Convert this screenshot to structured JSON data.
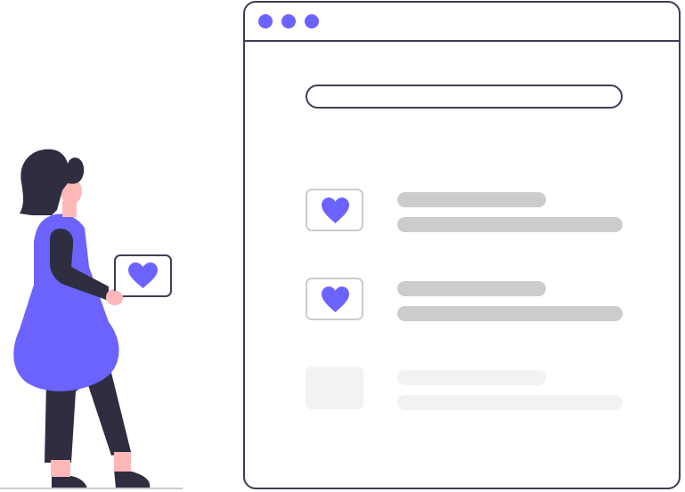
{
  "colors": {
    "accent": "#6c63ff",
    "outline": "#3f3d56",
    "placeholder": "#cccccc",
    "placeholder_faded": "#f2f2f2",
    "skin": "#ffb8b8",
    "dark": "#2f2e41"
  },
  "browser": {
    "window_dots": [
      "accent-dot",
      "accent-dot",
      "accent-dot"
    ],
    "search_bar": {
      "value": ""
    },
    "list_items": [
      {
        "icon": "heart-icon",
        "state": "liked"
      },
      {
        "icon": "heart-icon",
        "state": "liked"
      },
      {
        "icon": "none",
        "state": "placeholder"
      }
    ]
  },
  "person": {
    "holding_card_icon": "heart-icon"
  }
}
